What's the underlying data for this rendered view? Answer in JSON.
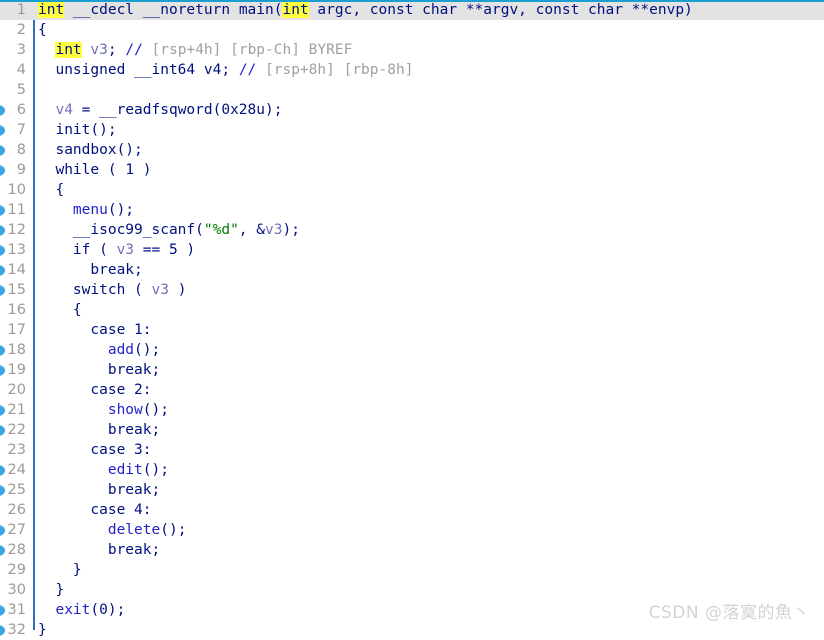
{
  "editor": {
    "kind": "decompiler-pseudocode-view",
    "colors": {
      "keyword": "#00107f",
      "function": "#2222cc",
      "variable": "#7070b8",
      "comment": "#a0a0a0",
      "string": "#008000",
      "highlight": "#ffff40",
      "current_line_bg": "#e3e3e3",
      "current_line_border": "#1a9fd0",
      "marker": "#3aa6e8",
      "fold_bar": "#2f6fc4",
      "line_number": "#9a9a9a",
      "background": "#ffffff"
    },
    "watermark": "CSDN @落寞的魚丶",
    "lines": [
      {
        "n": "1",
        "marker": false,
        "current": true,
        "tokens": [
          {
            "t": "int",
            "c": "kw hl"
          },
          {
            "t": " __cdecl __noreturn ",
            "c": "kw"
          },
          {
            "t": "main",
            "c": "kw"
          },
          {
            "t": "(",
            "c": "pun"
          },
          {
            "t": "int",
            "c": "kw hl"
          },
          {
            "t": " argc, const char **argv, const char **envp)",
            "c": "kw"
          }
        ]
      },
      {
        "n": "2",
        "marker": false,
        "current": false,
        "tokens": [
          {
            "t": "{",
            "c": "pun"
          }
        ]
      },
      {
        "n": "3",
        "marker": false,
        "current": false,
        "tokens": [
          {
            "t": "  ",
            "c": "pun"
          },
          {
            "t": "int",
            "c": "kw hl"
          },
          {
            "t": " ",
            "c": "pun"
          },
          {
            "t": "v3",
            "c": "var"
          },
          {
            "t": "; ",
            "c": "pun"
          },
          {
            "t": "// ",
            "c": "fn"
          },
          {
            "t": "[rsp+4h] [rbp-Ch] BYREF",
            "c": "cmt"
          }
        ]
      },
      {
        "n": "4",
        "marker": false,
        "current": false,
        "tokens": [
          {
            "t": "  unsigned __int64 ",
            "c": "kw"
          },
          {
            "t": "v4",
            "c": "kw"
          },
          {
            "t": "; ",
            "c": "pun"
          },
          {
            "t": "// ",
            "c": "fn"
          },
          {
            "t": "[rsp+8h] [rbp-8h]",
            "c": "cmt"
          }
        ]
      },
      {
        "n": "5",
        "marker": false,
        "current": false,
        "tokens": []
      },
      {
        "n": "6",
        "marker": true,
        "current": false,
        "tokens": [
          {
            "t": "  ",
            "c": "pun"
          },
          {
            "t": "v4",
            "c": "var"
          },
          {
            "t": " = __readfsqword(",
            "c": "kw"
          },
          {
            "t": "0x28u",
            "c": "num"
          },
          {
            "t": ");",
            "c": "pun"
          }
        ]
      },
      {
        "n": "7",
        "marker": true,
        "current": false,
        "tokens": [
          {
            "t": "  ",
            "c": "pun"
          },
          {
            "t": "init",
            "c": "kw"
          },
          {
            "t": "();",
            "c": "pun"
          }
        ]
      },
      {
        "n": "8",
        "marker": true,
        "current": false,
        "tokens": [
          {
            "t": "  ",
            "c": "pun"
          },
          {
            "t": "sandbox",
            "c": "kw"
          },
          {
            "t": "();",
            "c": "pun"
          }
        ]
      },
      {
        "n": "9",
        "marker": true,
        "current": false,
        "tokens": [
          {
            "t": "  while ( ",
            "c": "kw"
          },
          {
            "t": "1",
            "c": "num"
          },
          {
            "t": " )",
            "c": "kw"
          }
        ]
      },
      {
        "n": "10",
        "marker": false,
        "current": false,
        "tokens": [
          {
            "t": "  {",
            "c": "pun"
          }
        ]
      },
      {
        "n": "11",
        "marker": true,
        "current": false,
        "tokens": [
          {
            "t": "    ",
            "c": "pun"
          },
          {
            "t": "menu",
            "c": "fn"
          },
          {
            "t": "();",
            "c": "pun"
          }
        ]
      },
      {
        "n": "12",
        "marker": true,
        "current": false,
        "tokens": [
          {
            "t": "    __isoc99_scanf(",
            "c": "kw"
          },
          {
            "t": "\"%d\"",
            "c": "str"
          },
          {
            "t": ", &",
            "c": "pun"
          },
          {
            "t": "v3",
            "c": "var"
          },
          {
            "t": ");",
            "c": "pun"
          }
        ]
      },
      {
        "n": "13",
        "marker": true,
        "current": false,
        "tokens": [
          {
            "t": "    if ( ",
            "c": "kw"
          },
          {
            "t": "v3",
            "c": "var"
          },
          {
            "t": " == ",
            "c": "kw"
          },
          {
            "t": "5",
            "c": "num"
          },
          {
            "t": " )",
            "c": "kw"
          }
        ]
      },
      {
        "n": "14",
        "marker": true,
        "current": false,
        "tokens": [
          {
            "t": "      break;",
            "c": "kw"
          }
        ]
      },
      {
        "n": "15",
        "marker": true,
        "current": false,
        "tokens": [
          {
            "t": "    switch ( ",
            "c": "kw"
          },
          {
            "t": "v3",
            "c": "var"
          },
          {
            "t": " )",
            "c": "kw"
          }
        ]
      },
      {
        "n": "16",
        "marker": false,
        "current": false,
        "tokens": [
          {
            "t": "    {",
            "c": "pun"
          }
        ]
      },
      {
        "n": "17",
        "marker": false,
        "current": false,
        "tokens": [
          {
            "t": "      case ",
            "c": "kw"
          },
          {
            "t": "1",
            "c": "num"
          },
          {
            "t": ":",
            "c": "pun"
          }
        ]
      },
      {
        "n": "18",
        "marker": true,
        "current": false,
        "tokens": [
          {
            "t": "        ",
            "c": "pun"
          },
          {
            "t": "add",
            "c": "fn"
          },
          {
            "t": "();",
            "c": "pun"
          }
        ]
      },
      {
        "n": "19",
        "marker": true,
        "current": false,
        "tokens": [
          {
            "t": "        break;",
            "c": "kw"
          }
        ]
      },
      {
        "n": "20",
        "marker": false,
        "current": false,
        "tokens": [
          {
            "t": "      case ",
            "c": "kw"
          },
          {
            "t": "2",
            "c": "num"
          },
          {
            "t": ":",
            "c": "pun"
          }
        ]
      },
      {
        "n": "21",
        "marker": true,
        "current": false,
        "tokens": [
          {
            "t": "        ",
            "c": "pun"
          },
          {
            "t": "show",
            "c": "fn"
          },
          {
            "t": "();",
            "c": "pun"
          }
        ]
      },
      {
        "n": "22",
        "marker": true,
        "current": false,
        "tokens": [
          {
            "t": "        break;",
            "c": "kw"
          }
        ]
      },
      {
        "n": "23",
        "marker": false,
        "current": false,
        "tokens": [
          {
            "t": "      case ",
            "c": "kw"
          },
          {
            "t": "3",
            "c": "num"
          },
          {
            "t": ":",
            "c": "pun"
          }
        ]
      },
      {
        "n": "24",
        "marker": true,
        "current": false,
        "tokens": [
          {
            "t": "        ",
            "c": "pun"
          },
          {
            "t": "edit",
            "c": "fn"
          },
          {
            "t": "();",
            "c": "pun"
          }
        ]
      },
      {
        "n": "25",
        "marker": true,
        "current": false,
        "tokens": [
          {
            "t": "        break;",
            "c": "kw"
          }
        ]
      },
      {
        "n": "26",
        "marker": false,
        "current": false,
        "tokens": [
          {
            "t": "      case ",
            "c": "kw"
          },
          {
            "t": "4",
            "c": "num"
          },
          {
            "t": ":",
            "c": "pun"
          }
        ]
      },
      {
        "n": "27",
        "marker": true,
        "current": false,
        "tokens": [
          {
            "t": "        ",
            "c": "pun"
          },
          {
            "t": "delete",
            "c": "fn"
          },
          {
            "t": "();",
            "c": "pun"
          }
        ]
      },
      {
        "n": "28",
        "marker": true,
        "current": false,
        "tokens": [
          {
            "t": "        break;",
            "c": "kw"
          }
        ]
      },
      {
        "n": "29",
        "marker": false,
        "current": false,
        "tokens": [
          {
            "t": "    }",
            "c": "pun"
          }
        ]
      },
      {
        "n": "30",
        "marker": false,
        "current": false,
        "tokens": [
          {
            "t": "  }",
            "c": "pun"
          }
        ]
      },
      {
        "n": "31",
        "marker": true,
        "current": false,
        "tokens": [
          {
            "t": "  ",
            "c": "pun"
          },
          {
            "t": "exit",
            "c": "fn"
          },
          {
            "t": "(",
            "c": "pun"
          },
          {
            "t": "0",
            "c": "num"
          },
          {
            "t": ");",
            "c": "pun"
          }
        ]
      },
      {
        "n": "32",
        "marker": true,
        "current": false,
        "tokens": [
          {
            "t": "}",
            "c": "pun"
          }
        ]
      }
    ]
  }
}
